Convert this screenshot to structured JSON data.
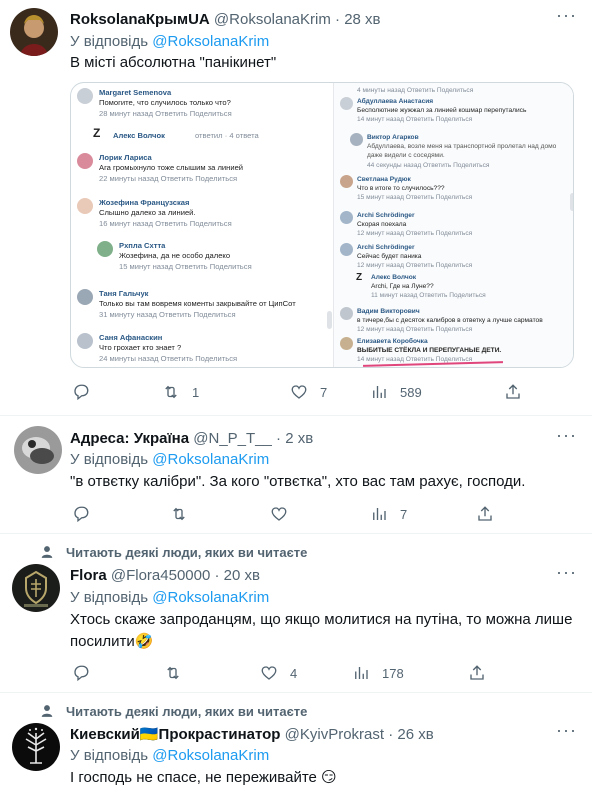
{
  "tweets": [
    {
      "name": "RoksolanaКрымUA",
      "handle": "@RoksolanaKrim",
      "time": "28 хв",
      "reply_prefix": "У відповідь",
      "reply_to": "@RoksolanaKrim",
      "text": "В місті абсолютна \"панікинет\"",
      "replies": "",
      "retweets": "1",
      "likes": "7",
      "views": "589"
    },
    {
      "name": "Адреса: Україна",
      "handle": "@N_P_T__",
      "time": "2 хв",
      "reply_prefix": "У відповідь",
      "reply_to": "@RoksolanaKrim",
      "text": "\"в отвєтку калібри\". За кого \"отвєтка\", хто вас там рахує, господи.",
      "replies": "",
      "retweets": "",
      "likes": "",
      "views": "7"
    },
    {
      "social": "Читають деякі люди, яких ви читаєте",
      "name": "Flora",
      "handle": "@Flora450000",
      "time": "20 хв",
      "reply_prefix": "У відповідь",
      "reply_to": "@RoksolanaKrim",
      "text": "Хтось скаже запроданцям, що якщо молитися на путіна, то можна лише посилити🤣",
      "replies": "",
      "retweets": "",
      "likes": "4",
      "views": "178"
    },
    {
      "social": "Читають деякі люди, яких ви читаєте",
      "name": "Киевский🇺🇦Прокрастинатор",
      "handle": "@KyivProkrast",
      "time": "26 хв",
      "reply_prefix": "У відповідь",
      "reply_to": "@RoksolanaKrim",
      "text": "І господь не спасе, не переживайте 😏"
    }
  ],
  "media": {
    "left": [
      {
        "name": "Margaret Semenova",
        "text": "Помогите, что случилось только что?",
        "meta": "28 минут назад  Ответить  Поделиться"
      },
      {
        "name": "Алекс Волчок",
        "text": "ответил · 4 ответа",
        "meta": ""
      },
      {
        "name": "Лорик Лариса",
        "text": "Ага громыхнуло тоже слышим за линией",
        "meta": "22 минуты назад  Ответить  Поделиться"
      },
      {
        "name": "Жозефина Французская",
        "text": "Слышно далеко за линией.",
        "meta": "16 минут назад  Ответить  Поделиться"
      },
      {
        "name": "Рхпла Схтта",
        "text": "Жозефина, да не особо далеко",
        "meta": "15 минут назад  Ответить  Поделиться"
      },
      {
        "name": "Таня Гальчук",
        "text": "Только вы там вовремя коменты закрывайте от ЦипСот",
        "meta": "31 минуту назад  Ответить  Поделиться"
      },
      {
        "name": "Саня Афанаскин",
        "text": "Что грохает кто знает ?",
        "meta": "24 минуты назад  Ответить  Поделиться"
      }
    ],
    "right": [
      {
        "name": "",
        "text": "",
        "meta": "4 минуты назад  Ответить  Поделиться"
      },
      {
        "name": "Абдуллаева Анастасия",
        "text": "Бесполютние жужжал за линией кошмар перепутались",
        "meta": "14 минут назад  Ответить  Поделиться"
      },
      {
        "name": "Виктор Агарков",
        "text": "Абдуллаева, возле меня на транспортной пролетал над домо даже видели с соседями.",
        "meta": "44 секунды назад  Ответить  Поделиться"
      },
      {
        "name": "Светлана Рудюк",
        "text": "Что в итоге то случилось???",
        "meta": "15 минут назад  Ответить  Поделиться"
      },
      {
        "name": "Archi Schrödinger",
        "text": "Скорая поехала",
        "meta": "12 минут назад  Ответить  Поделиться"
      },
      {
        "name": "Archi Schrödinger",
        "text": "Сейчас будет паника",
        "meta": "12 минут назад  Ответить  Поделиться"
      },
      {
        "name": "Алекс Волчок",
        "text": "Archi, Где на Луне??",
        "meta": "11 минут назад  Ответить  Поделиться"
      },
      {
        "name": "Вадим Викторович",
        "text": "в тичере,бы с десяток калибров в ответку а лучше сарматов",
        "meta": "12 минут назад  Ответить  Поделиться"
      },
      {
        "name": "Елизавета Коробочка",
        "text": "ВЫБИТЫЕ СТЁКЛА И ПЕРЕПУГАНЫЕ ДЕТИ.",
        "meta": "14 минут назад  Ответить  Поделиться"
      }
    ]
  },
  "colors": {
    "accent": "#1d9bf0",
    "secondary_text": "#536471",
    "divider": "#eff3f4"
  },
  "icons": [
    "reply-icon",
    "retweet-icon",
    "like-icon",
    "views-icon",
    "share-icon",
    "more-icon",
    "person-icon"
  ]
}
